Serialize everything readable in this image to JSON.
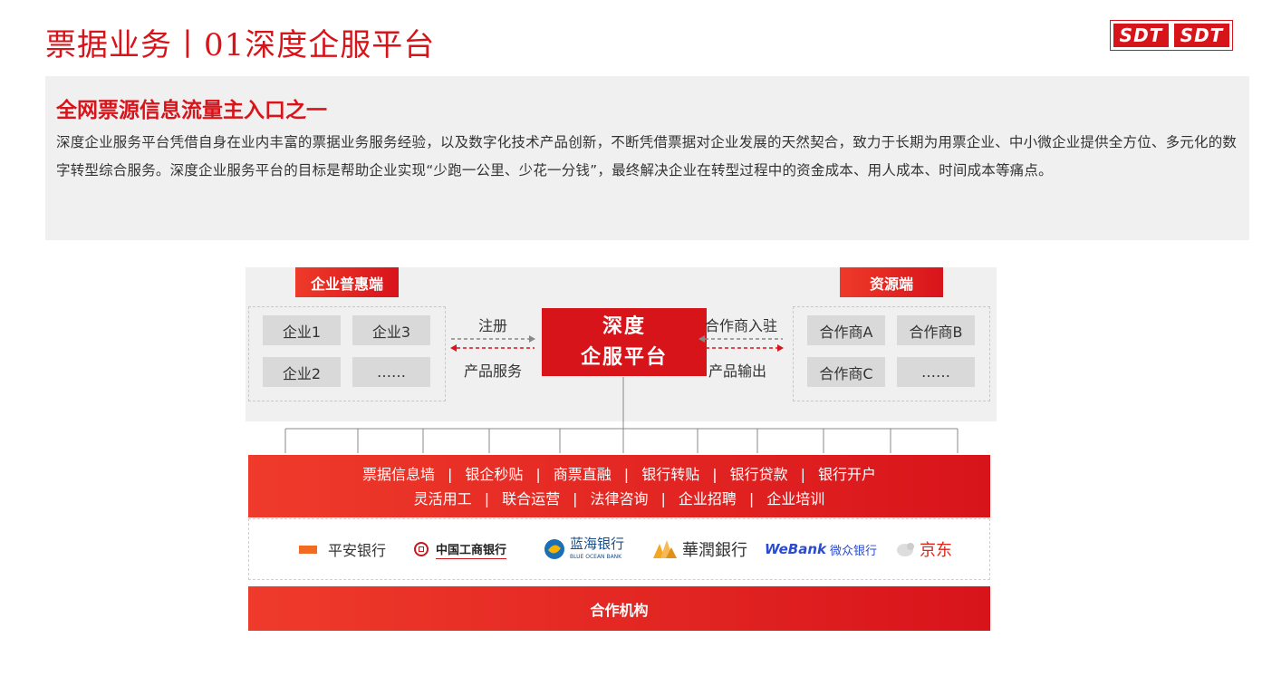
{
  "header": {
    "title": "票据业务丨01深度企服平台",
    "logo_left": "SDT",
    "logo_right": "SDT"
  },
  "intro": {
    "heading": "全网票源信息流量主入口之一",
    "body": "深度企业服务平台凭借自身在业内丰富的票据业务服务经验，以及数字化技术产品创新，不断凭借票据对企业发展的天然契合，致力于长期为用票企业、中小微企业提供全方位、多元化的数字转型综合服务。深度企业服务平台的目标是帮助企业实现“少跑一公里、少花一分钱”，最终解决企业在转型过程中的资金成本、用人成本、时间成本等痛点。"
  },
  "diagram": {
    "left_group": {
      "tag": "企业普惠端",
      "items": [
        "企业1",
        "企业3",
        "企业2",
        "……"
      ]
    },
    "right_group": {
      "tag": "资源端",
      "items": [
        "合作商A",
        "合作商B",
        "合作商C",
        "……"
      ]
    },
    "left_arrows": {
      "top_label": "注册",
      "bottom_label": "产品服务"
    },
    "right_arrows": {
      "top_label": "合作商入驻",
      "bottom_label": "产品输出"
    },
    "platform": {
      "line1": "深度",
      "line2": "企服平台"
    }
  },
  "services": {
    "row1": [
      "票据信息墙",
      "银企秒贴",
      "商票直融",
      "银行转贴",
      "银行贷款",
      "银行开户"
    ],
    "row2": [
      "灵活用工",
      "联合运营",
      "法律咨询",
      "企业招聘",
      "企业培训"
    ],
    "separator": "|"
  },
  "partners": {
    "banks": [
      {
        "name": "平安银行",
        "icon": "pingan-logo-icon"
      },
      {
        "name": "中国工商银行",
        "icon": "icbc-logo-icon"
      },
      {
        "name": "蓝海银行",
        "sub": "BLUE OCEAN BANK",
        "icon": "blue-ocean-logo-icon"
      },
      {
        "name": "華潤銀行",
        "icon": "huarun-logo-icon"
      },
      {
        "name_en": "WeBank",
        "name": "微众银行",
        "icon": "webank-logo-icon"
      },
      {
        "name": "京东",
        "icon": "jd-logo-icon"
      }
    ],
    "label": "合作机构"
  },
  "colors": {
    "brand_red": "#d8141b",
    "gradient_start": "#ef3b2b",
    "panel_gray": "#f0f0f0",
    "chip_gray": "#d9d9d9"
  }
}
